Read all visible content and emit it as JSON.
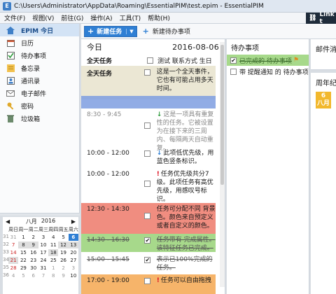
{
  "window": {
    "title": "C:\\Users\\Administrator\\AppData\\Roaming\\EssentialPIM\\test.epim - EssentialPIM",
    "app_icon": "E"
  },
  "menu": [
    "文件(F)",
    "视图(V)",
    "前往(G)",
    "操作(A)",
    "工具(T)",
    "帮助(H)"
  ],
  "link_button": "Link t",
  "toolbar": {
    "new_task": "新建任务",
    "new_todo": "新建待办事项"
  },
  "sidebar": {
    "items": [
      {
        "label": "EPIM 今日",
        "icon": "home-icon"
      },
      {
        "label": "日历",
        "icon": "calendar-icon"
      },
      {
        "label": "待办事项",
        "icon": "todo-icon"
      },
      {
        "label": "备忘录",
        "icon": "notes-icon"
      },
      {
        "label": "通讯录",
        "icon": "contacts-icon"
      },
      {
        "label": "电子邮件",
        "icon": "mail-icon"
      },
      {
        "label": "密码",
        "icon": "key-icon"
      },
      {
        "label": "垃圾箱",
        "icon": "trash-icon"
      }
    ]
  },
  "minical": {
    "month": "八月",
    "year": "2016",
    "weekdays": [
      "周日",
      "周一",
      "周二",
      "周三",
      "周四",
      "周五",
      "周六"
    ],
    "weeks": [
      {
        "wk": "31",
        "days": [
          "31",
          "1",
          "2",
          "3",
          "4",
          "5",
          "6"
        ]
      },
      {
        "wk": "32",
        "days": [
          "7",
          "8",
          "9",
          "10",
          "11",
          "12",
          "13"
        ]
      },
      {
        "wk": "33",
        "days": [
          "14",
          "15",
          "16",
          "17",
          "18",
          "19",
          "20"
        ]
      },
      {
        "wk": "34",
        "days": [
          "21",
          "22",
          "23",
          "24",
          "25",
          "26",
          "27"
        ]
      },
      {
        "wk": "35",
        "days": [
          "28",
          "29",
          "30",
          "31",
          "1",
          "2",
          "3"
        ]
      },
      {
        "wk": "36",
        "days": [
          "4",
          "5",
          "6",
          "7",
          "8",
          "9",
          "10"
        ]
      }
    ],
    "selected": "6"
  },
  "today": {
    "title": "今日",
    "date": "2016-08-06",
    "allday_label_1": "全天任务",
    "allday_text_1": "测试 联系方式 生日",
    "allday_label_2": "全天任务",
    "allday_text_2": "这是一个全天事件，它也有可能占用多天时间。",
    "events": [
      {
        "time": "8:30 - 9:45",
        "text": "这是一项具有重复性的任务。它被设置为在接下来的三周内、每隔两天自动重复。"
      },
      {
        "time": "10:00 - 12:00",
        "text": "此项低优先级，用蓝色竖条标识。"
      },
      {
        "time": "10:00 - 12:00",
        "text": "任务优先级共分7级。此项任务有高优先级，用感叹号标识。"
      },
      {
        "time": "12:30 - 14:30",
        "text": "任务可分配不同 背景色。颜色来自预定义或者自定义的颜色。"
      },
      {
        "time": "14:30 - 16:30",
        "text": "任务带有 完成属性。该特征任务已完成。"
      },
      {
        "time": "15:00 - 15:45",
        "text": "表示已100%完成的任务。"
      },
      {
        "time": "17:00 - 19:00",
        "text": "任务可以自由拖拽"
      }
    ]
  },
  "todo": {
    "title": "待办事项",
    "items": [
      {
        "text": "已完成的 待办事项",
        "done": true
      },
      {
        "text": "带 提醒通知 的 待办事项",
        "done": false
      }
    ]
  },
  "mail": {
    "title": "邮件消"
  },
  "anniversary": {
    "title": "周年纪",
    "badge_day": "6",
    "badge_month": "八月"
  },
  "colors": {
    "accent": "#2f7fd4",
    "pink": "#f08d80",
    "green": "#a7d98b",
    "beige": "#ebe7d4",
    "orange": "#f6b46a",
    "blue_bar": "#7e9ee0"
  }
}
